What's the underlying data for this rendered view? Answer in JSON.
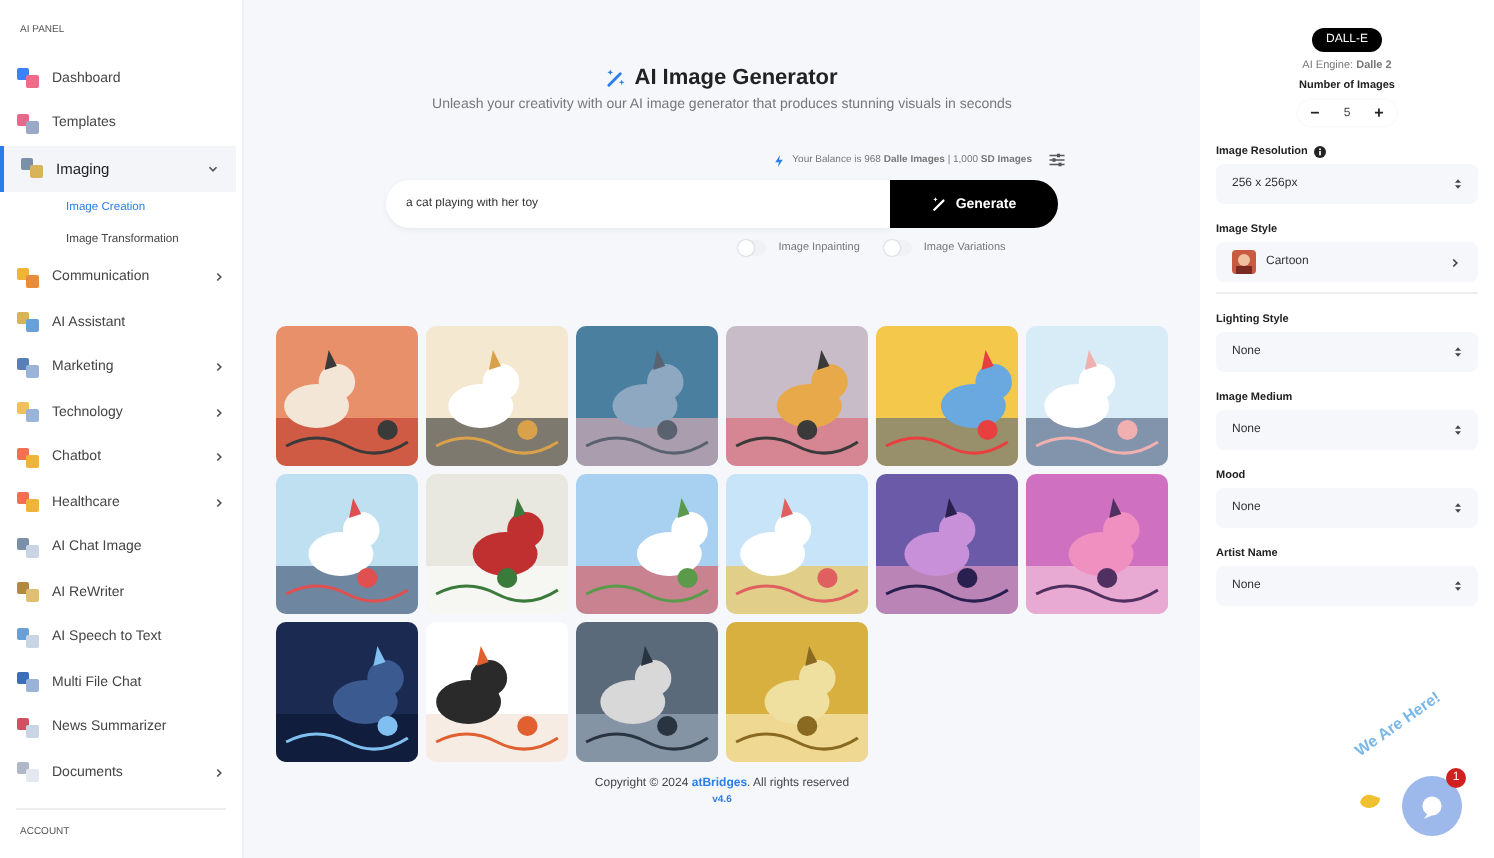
{
  "sidebar": {
    "section_title": "AI PANEL",
    "items": [
      {
        "label": "Dashboard",
        "selected": false
      },
      {
        "label": "Templates",
        "selected": false
      },
      {
        "label": "Imaging",
        "selected": true,
        "expanded": true,
        "children": [
          {
            "label": "Image Creation",
            "selected": true
          },
          {
            "label": "Image Transformation",
            "selected": false
          }
        ]
      },
      {
        "label": "Communication",
        "selected": false,
        "expanded": false
      },
      {
        "label": "AI Assistant",
        "selected": false
      },
      {
        "label": "Marketing",
        "selected": false,
        "expanded": false
      },
      {
        "label": "Technology",
        "selected": false,
        "expanded": false
      },
      {
        "label": "Chatbot",
        "selected": false,
        "expanded": false
      },
      {
        "label": "Healthcare",
        "selected": false,
        "expanded": false
      },
      {
        "label": "AI Chat Image",
        "selected": false
      },
      {
        "label": "AI ReWriter",
        "selected": false
      },
      {
        "label": "AI Speech to Text",
        "selected": false
      },
      {
        "label": "Multi File Chat",
        "selected": false
      },
      {
        "label": "News Summarizer",
        "selected": false
      },
      {
        "label": "Documents",
        "selected": false,
        "expanded": false
      }
    ],
    "footer_section_title": "ACCOUNT"
  },
  "main": {
    "title": "AI Image Generator",
    "subtitle": "Unleash your creativity with our AI image generator that produces stunning visuals in seconds",
    "balance": "Your Balance is 968 **Dalle Images** | 1,000 **SD Images**",
    "prompt": {
      "value": "a cat playing with her toy"
    },
    "generate_button": "Generate",
    "toggles": [
      {
        "label": "Image Inpainting",
        "on": false
      },
      {
        "label": "Image Variations",
        "on": false
      }
    ],
    "footer": {
      "copyright": "Copyright © 2024",
      "link": "atBridges",
      "rights": ". All rights reserved",
      "version": "v4.6"
    }
  },
  "settings": {
    "engine_badge": "DALL-E",
    "engine_label": "AI Engine: **Dalle 2**",
    "count_label": "Number of Images",
    "count": "5",
    "minus": "−",
    "plus": "+",
    "fields": [
      {
        "label": "Image Resolution",
        "kind": "select",
        "value": "256 x 256px",
        "info": true
      },
      {
        "label": "Image Style",
        "kind": "style",
        "value": "Cartoon"
      },
      {
        "label": "Lighting Style",
        "kind": "select",
        "value": "None"
      },
      {
        "label": "Image Medium",
        "kind": "select",
        "value": "None"
      },
      {
        "label": "Mood",
        "kind": "select",
        "value": "None"
      },
      {
        "label": "Artist Name",
        "kind": "select",
        "value": "None"
      }
    ]
  },
  "chat_widget": {
    "text": "We Are Here!",
    "badge": "1"
  }
}
